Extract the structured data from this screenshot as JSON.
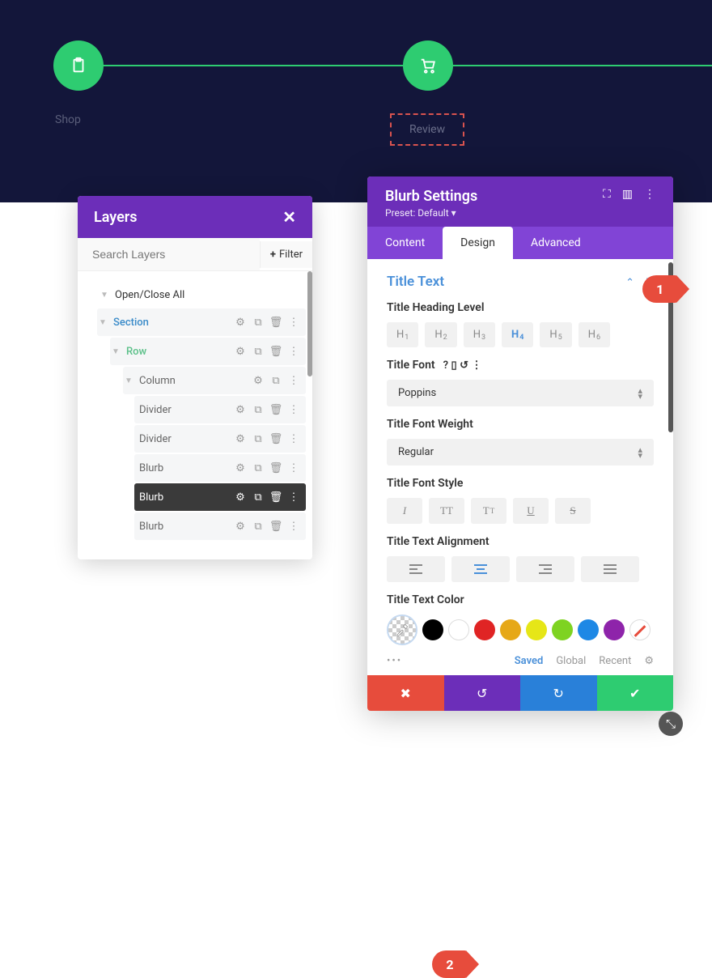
{
  "hero": {
    "step1_label": "Shop",
    "step2_label": "Review"
  },
  "layers": {
    "title": "Layers",
    "search_placeholder": "Search Layers",
    "filter_label": "Filter",
    "open_close_all": "Open/Close All",
    "items": {
      "section": "Section",
      "row": "Row",
      "column": "Column",
      "divider1": "Divider",
      "divider2": "Divider",
      "blurb1": "Blurb",
      "blurb2": "Blurb",
      "blurb3": "Blurb"
    }
  },
  "settings": {
    "title": "Blurb Settings",
    "preset": "Preset: Default ▾",
    "tabs": {
      "content": "Content",
      "design": "Design",
      "advanced": "Advanced"
    },
    "callouts": {
      "c1": "1",
      "c2": "2"
    },
    "section_title": "Title Text",
    "heading_level": {
      "label": "Title Heading Level",
      "options": [
        "H",
        "H",
        "H",
        "H",
        "H",
        "H"
      ]
    },
    "font": {
      "label": "Title Font",
      "value": "Poppins"
    },
    "weight": {
      "label": "Title Font Weight",
      "value": "Regular"
    },
    "style": {
      "label": "Title Font Style"
    },
    "align": {
      "label": "Title Text Alignment"
    },
    "color": {
      "label": "Title Text Color",
      "swatches": [
        "#000000",
        "#ffffff",
        "#e02424",
        "#e6a817",
        "#e6e617",
        "#7ed321",
        "#1e88e5",
        "#8e24aa"
      ]
    },
    "filters": {
      "saved": "Saved",
      "global": "Global",
      "recent": "Recent"
    }
  }
}
